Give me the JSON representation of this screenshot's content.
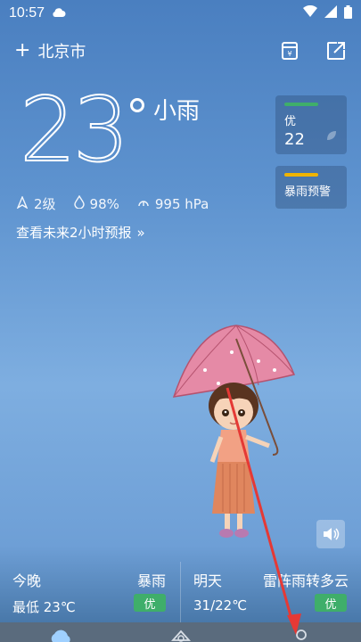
{
  "status": {
    "time": "10:57"
  },
  "header": {
    "city": "北京市",
    "add_symbol": "+"
  },
  "current": {
    "temperature": "23",
    "condition": "小雨",
    "wind": "2级",
    "humidity": "98%",
    "pressure": "995 hPa",
    "forecast_link": "查看未来2小时预报",
    "forecast_chevron": "»"
  },
  "aqi": {
    "label": "优",
    "value": "22",
    "bar_color": "#3fae6a"
  },
  "warning": {
    "label": "暴雨预警",
    "bar_color": "#f0b400"
  },
  "bottom_forecast": {
    "tonight": {
      "day": "今晚",
      "range": "最低 23℃",
      "weather": "暴雨",
      "quality": "优"
    },
    "tomorrow": {
      "day": "明天",
      "range": "31/22℃",
      "weather": "雷阵雨转多云",
      "quality": "优"
    }
  },
  "nav": {
    "tabs": [
      "weather-icon",
      "explore-icon",
      "profile-icon"
    ]
  }
}
